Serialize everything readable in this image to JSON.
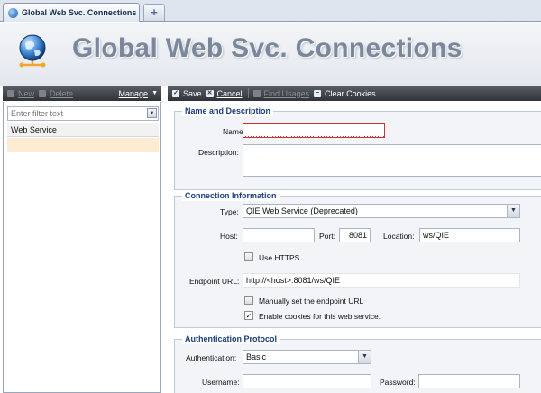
{
  "tab": {
    "title": "Global Web Svc. Connections",
    "add_label": "+"
  },
  "header": {
    "title": "Global Web Svc. Connections"
  },
  "left_toolbar": {
    "new_label": "New",
    "delete_label": "Delete",
    "manage_label": "Manage"
  },
  "right_toolbar": {
    "save_label": "Save",
    "cancel_label": "Cancel",
    "find_usages_label": "Find Usages",
    "clear_cookies_label": "Clear Cookies"
  },
  "left_panel": {
    "filter_placeholder": "Enter filter text",
    "list_header": "Web Service",
    "rows": [
      ""
    ]
  },
  "name_description": {
    "legend": "Name and Description",
    "name_label": "Name:",
    "name_value": "",
    "description_label": "Description:",
    "description_value": ""
  },
  "connection": {
    "legend": "Connection Information",
    "type_label": "Type:",
    "type_value": "QIE Web Service (Deprecated)",
    "host_label": "Host:",
    "host_value": "",
    "port_label": "Port:",
    "port_value": "8081",
    "location_label": "Location:",
    "location_value": "ws/QIE",
    "use_https_label": "Use HTTPS",
    "use_https_checked": false,
    "endpoint_label": "Endpoint URL:",
    "endpoint_value": "http://<host>:8081/ws/QIE",
    "manual_endpoint_label": "Manually set the endpoint URL",
    "manual_endpoint_checked": false,
    "cookies_label": "Enable cookies for this web service.",
    "cookies_checked": true
  },
  "auth": {
    "legend": "Authentication Protocol",
    "auth_label": "Authentication:",
    "auth_value": "Basic",
    "username_label": "Username:",
    "username_value": "",
    "password_label": "Password:",
    "password_value": ""
  },
  "colors": {
    "accent": "#1a3d7c",
    "selected_row": "#fdecd2",
    "toolbar": "#3a3e44",
    "invalid": "#cc3333"
  },
  "icons": {
    "tab": "globe-icon",
    "header": "network-globe-icon",
    "save": "check-icon",
    "cancel": "x-icon",
    "clear": "minus-icon"
  }
}
